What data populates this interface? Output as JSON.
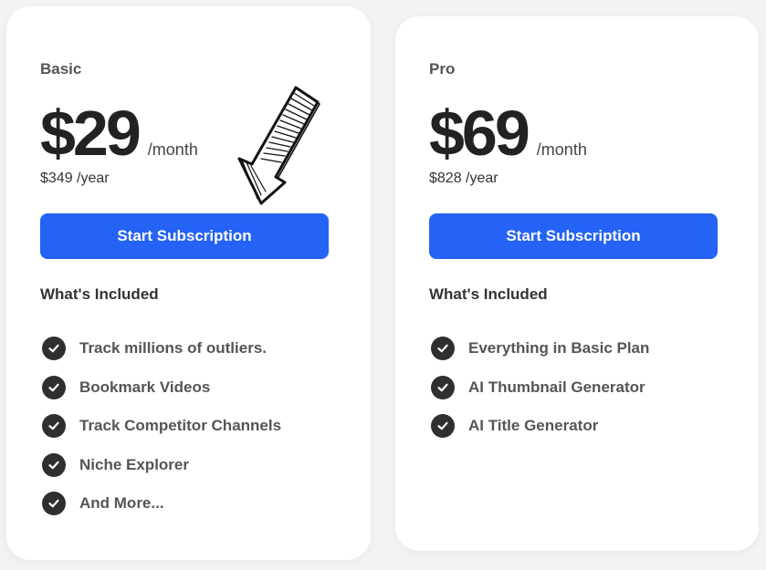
{
  "plans": [
    {
      "name": "Basic",
      "price": "$29",
      "per": "/month",
      "yearly": "$349 /year",
      "cta": "Start Subscription",
      "included_label": "What's Included",
      "features": [
        "Track millions of outliers.",
        "Bookmark Videos",
        "Track Competitor Channels",
        "Niche Explorer",
        "And More..."
      ]
    },
    {
      "name": "Pro",
      "price": "$69",
      "per": "/month",
      "yearly": "$828 /year",
      "cta": "Start Subscription",
      "included_label": "What's Included",
      "features": [
        "Everything in Basic Plan",
        "AI Thumbnail Generator",
        "AI Title Generator"
      ]
    }
  ],
  "icons": {
    "feature_check": "check-circle-icon",
    "annotation": "hand-drawn-arrow-icon"
  },
  "colors": {
    "accent": "#2463f5",
    "card": "#ffffff",
    "background": "#f2f3f5",
    "check": "#2f2f2f"
  }
}
